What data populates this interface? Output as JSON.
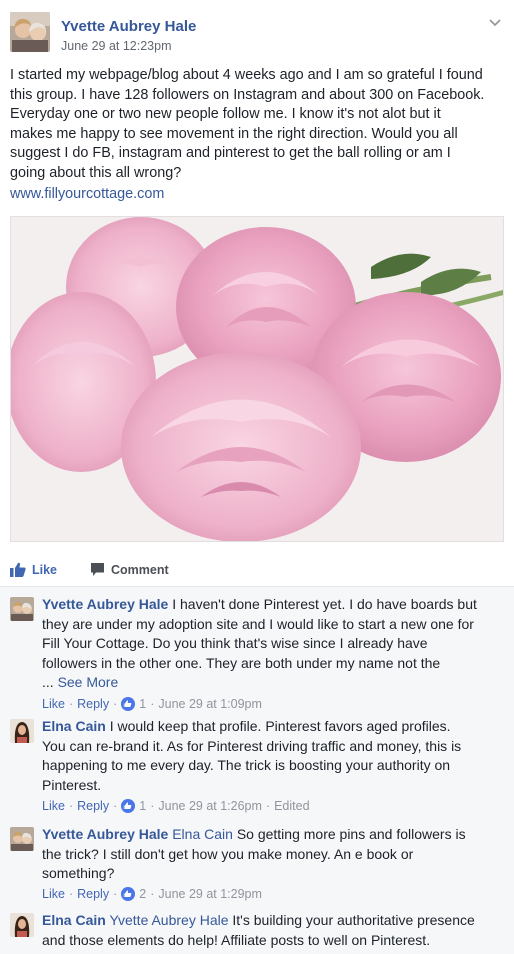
{
  "post": {
    "author": "Yvette Aubrey Hale",
    "timestamp": "June 29 at 12:23pm",
    "text_lines": [
      "I started my webpage/blog about 4 weeks ago and I am so grateful I found",
      "this group. I have 128 followers on Instagram and about 300 on Facebook.",
      "Everyday one or two new people follow me. I know it's not alot but it",
      "makes me happy to see movement in the right direction. Would you all",
      "suggest I do FB, instagram and pinterest to get the ball rolling or am I",
      "going about this all wrong?"
    ],
    "link": "www.fillyourcottage.com",
    "icons": {
      "options": "chevron-down-icon",
      "photo": "peony-photo"
    }
  },
  "actions": {
    "like_label": "Like",
    "comment_label": "Comment"
  },
  "comments": [
    {
      "author": "Yvette Aubrey Hale",
      "tag": "",
      "lines": [
        "I haven't done Pinterest yet. I do have boards but",
        "they are under my adoption site and I would like to start a new one for",
        "Fill Your Cottage. Do you think that's wise since I already have",
        "followers in the other one. They are both under my name not the",
        "..."
      ],
      "see_more": "See More",
      "like": "Like",
      "reply": "Reply",
      "reactions": "1",
      "time": "June 29 at 1:09pm",
      "edited": ""
    },
    {
      "author": "Elna Cain",
      "tag": "",
      "lines": [
        "I would keep that profile. Pinterest favors aged profiles.",
        "You can re-brand it. As for Pinterest driving traffic and money, this is",
        "happening to me every day. The trick is boosting your authority on",
        "Pinterest."
      ],
      "see_more": "",
      "like": "Like",
      "reply": "Reply",
      "reactions": "1",
      "time": "June 29 at 1:26pm",
      "edited": "Edited"
    },
    {
      "author": "Yvette Aubrey Hale",
      "tag": "Elna Cain",
      "lines": [
        "So getting more pins and followers is",
        "the trick? I still don't get how you make money. An e book or",
        "something?"
      ],
      "see_more": "",
      "like": "Like",
      "reply": "Reply",
      "reactions": "2",
      "time": "June 29 at 1:29pm",
      "edited": ""
    },
    {
      "author": "Elna Cain",
      "tag": "Yvette Aubrey Hale",
      "lines": [
        "It's building your authoritative presence",
        "and those elements do help! Affiliate posts to well on Pinterest."
      ],
      "see_more": "",
      "like": "",
      "reply": "",
      "reactions": "",
      "time": "",
      "edited": ""
    }
  ],
  "colors": {
    "link_blue": "#365899",
    "action_blue": "#4267b2",
    "meta_gray": "#90949c",
    "comments_bg": "#f6f7f9"
  }
}
